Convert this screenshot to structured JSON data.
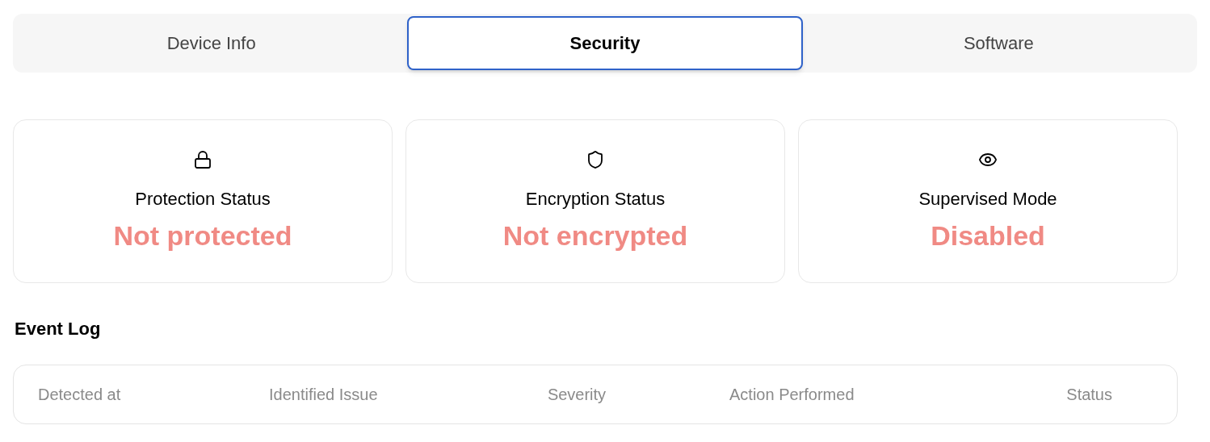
{
  "tabs": [
    {
      "label": "Device Info",
      "selected": false
    },
    {
      "label": "Security",
      "selected": true
    },
    {
      "label": "Software",
      "selected": false
    }
  ],
  "status_cards": [
    {
      "kind": "lock",
      "title": "Protection Status",
      "value": "Not protected",
      "ok": false
    },
    {
      "kind": "shield",
      "title": "Encryption Status",
      "value": "Not encrypted",
      "ok": false
    },
    {
      "kind": "eye",
      "title": "Supervised Mode",
      "value": "Disabled",
      "ok": false
    }
  ],
  "event_log": {
    "title": "Event Log",
    "columns": [
      "Detected at",
      "Identified Issue",
      "Severity",
      "Action Performed",
      "Status"
    ]
  }
}
